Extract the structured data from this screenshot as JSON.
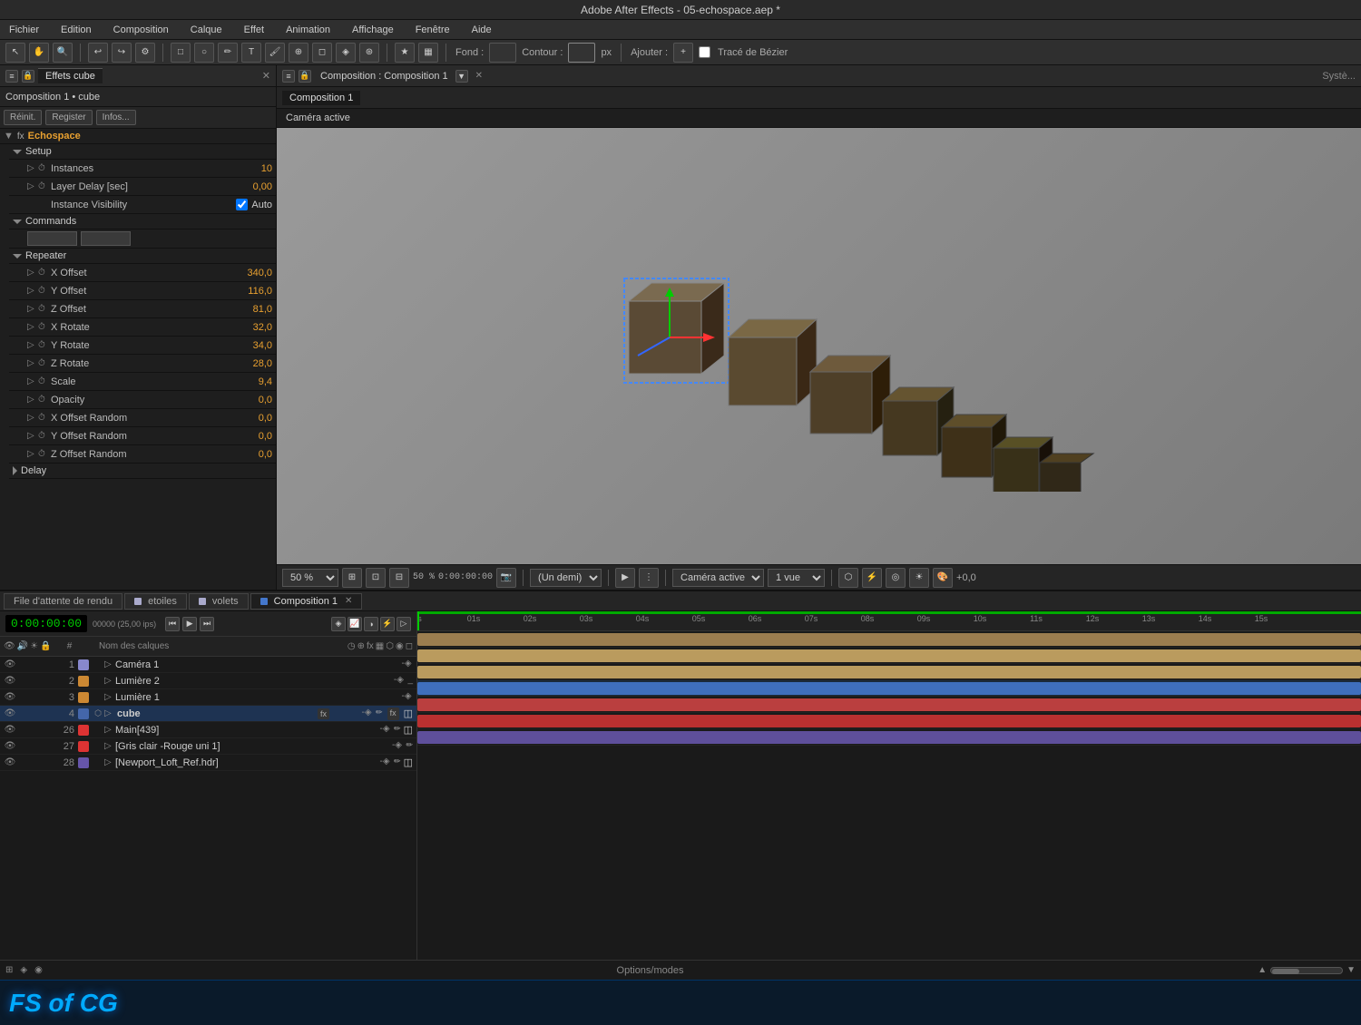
{
  "app": {
    "title": "Adobe After Effects - 05-echospace.aep *",
    "menu": {
      "items": [
        "Fichier",
        "Edition",
        "Composition",
        "Calque",
        "Effet",
        "Animation",
        "Affichage",
        "Fenêtre",
        "Aide"
      ]
    }
  },
  "toolbar": {
    "fond_label": "Fond :",
    "contour_label": "Contour :",
    "px_label": "px",
    "ajouter_label": "Ajouter :",
    "trace_bezier_label": "Tracé de Bézier"
  },
  "left_panel": {
    "tab_label": "Effets cube",
    "comp_info": "Composition 1 • cube",
    "echospace_name": "Echospace",
    "reinit_label": "Réinit.",
    "register_label": "Register",
    "infos_label": "Infos...",
    "sections": {
      "setup": {
        "label": "Setup",
        "properties": [
          {
            "name": "Instances",
            "value": "10"
          },
          {
            "name": "Layer Delay [sec]",
            "value": "0,00"
          },
          {
            "name": "Instance Visibility",
            "value": "Auto",
            "type": "checkbox"
          }
        ]
      },
      "commands": {
        "label": "Commands",
        "buttons": [
          "",
          ""
        ]
      },
      "repeater": {
        "label": "Repeater",
        "properties": [
          {
            "name": "X Offset",
            "value": "340,0"
          },
          {
            "name": "Y Offset",
            "value": "116,0"
          },
          {
            "name": "Z Offset",
            "value": "81,0"
          },
          {
            "name": "X Rotate",
            "value": "32,0"
          },
          {
            "name": "Y Rotate",
            "value": "34,0"
          },
          {
            "name": "Z Rotate",
            "value": "28,0"
          },
          {
            "name": "Scale",
            "value": "9,4"
          },
          {
            "name": "Opacity",
            "value": "0,0"
          },
          {
            "name": "X Offset Random",
            "value": "0,0"
          },
          {
            "name": "Y Offset Random",
            "value": "0,0"
          },
          {
            "name": "Z Offset Random",
            "value": "0,0"
          }
        ]
      },
      "delay": {
        "label": "Delay"
      }
    }
  },
  "comp_viewer": {
    "panel_title": "Composition : Composition 1",
    "tab_label": "Composition 1",
    "active_camera": "Caméra active",
    "zoom": "50 %",
    "quality": "(Un demi)",
    "camera": "Caméra active",
    "views": "1 vue",
    "offset": "+0,0"
  },
  "timeline": {
    "tabs": [
      {
        "label": "File d'attente de rendu",
        "active": false
      },
      {
        "label": "etoiles",
        "active": false
      },
      {
        "label": "volets",
        "active": false
      },
      {
        "label": "Composition 1",
        "active": true
      }
    ],
    "time_display": "0:00:00:00",
    "fps": "00000 (25,00 ips)",
    "column_headers": {
      "name": "Nom des calques"
    },
    "layers": [
      {
        "num": 1,
        "name": "Caméra 1",
        "color": "#8888cc",
        "type": "camera",
        "vis": true,
        "has3d": false
      },
      {
        "num": 2,
        "name": "Lumière 2",
        "color": "#ccaa44",
        "type": "light",
        "vis": true,
        "has3d": false
      },
      {
        "num": 3,
        "name": "Lumière 1",
        "color": "#ccaa44",
        "type": "light",
        "vis": true,
        "has3d": false
      },
      {
        "num": 4,
        "name": "cube",
        "color": "#4466aa",
        "type": "solid",
        "vis": true,
        "has3d": true,
        "selected": true,
        "hasFx": true
      },
      {
        "num": 26,
        "name": "Main[439]",
        "color": "#dd3333",
        "type": "solid",
        "vis": true,
        "has3d": false
      },
      {
        "num": 27,
        "name": "[Gris clair -Rouge uni 1]",
        "color": "#dd3333",
        "type": "solid",
        "vis": true,
        "has3d": false
      },
      {
        "num": 28,
        "name": "[Newport_Loft_Ref.hdr]",
        "color": "#6655aa",
        "type": "footage",
        "vis": true,
        "has3d": false
      }
    ],
    "track_colors": {
      "camera": "#bb9966",
      "light1": "#ddbb88",
      "light2": "#ddbb88",
      "cube": "#4477cc",
      "main": "#cc4444",
      "rouge": "#cc4444",
      "hdr": "#7766aa"
    }
  },
  "footer": {
    "options_modes_label": "Options/modes"
  },
  "brand": {
    "text": "FS of CG"
  }
}
